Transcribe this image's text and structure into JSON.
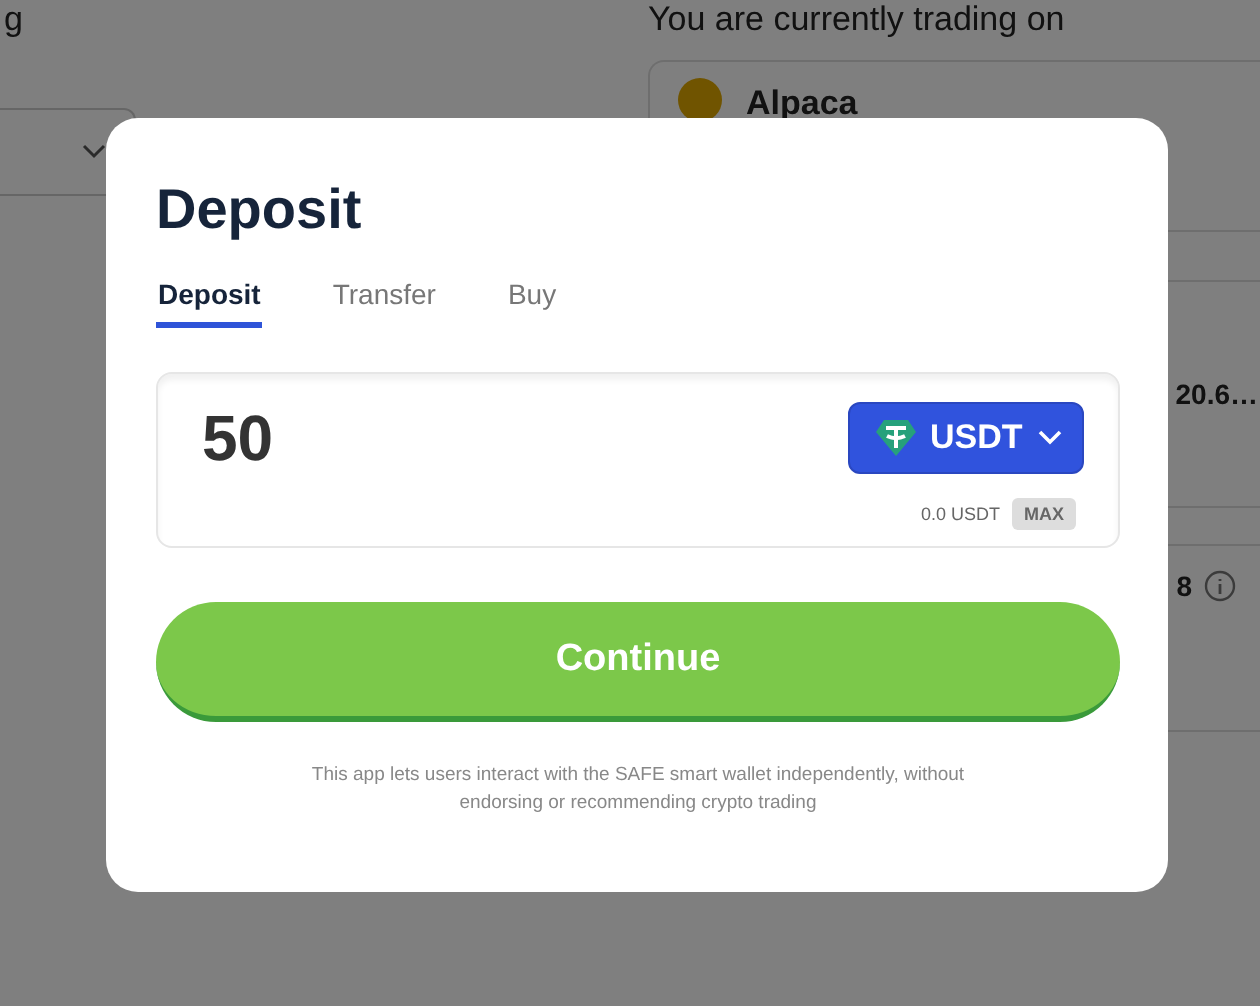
{
  "background": {
    "left_heading": "g",
    "right_heading": "You are currently trading on",
    "broker": {
      "name": "Alpaca"
    },
    "value_1": "20.6…",
    "value_2": "8"
  },
  "modal": {
    "title": "Deposit",
    "tabs": [
      {
        "label": "Deposit",
        "selected": true
      },
      {
        "label": "Transfer",
        "selected": false
      },
      {
        "label": "Buy",
        "selected": false
      }
    ],
    "amount": {
      "value": "50"
    },
    "currency": {
      "label": "USDT"
    },
    "balance": "0.0 USDT",
    "max_button": "MAX",
    "continue_button": "Continue",
    "disclaimer": "This app lets users interact with the SAFE smart wallet independently, without endorsing or recommending crypto trading"
  }
}
